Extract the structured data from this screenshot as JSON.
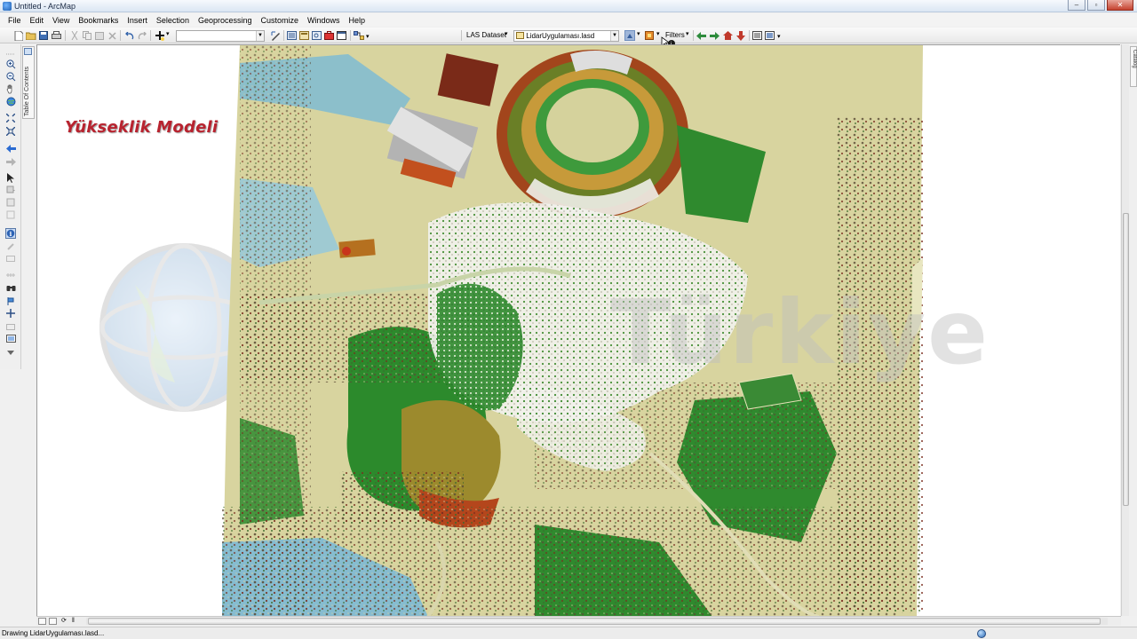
{
  "window": {
    "title": "Untitled - ArcMap"
  },
  "menu": [
    "File",
    "Edit",
    "View",
    "Bookmarks",
    "Insert",
    "Selection",
    "Geoprocessing",
    "Customize",
    "Windows",
    "Help"
  ],
  "toolbar": {
    "scale_value": "",
    "las_dataset_label": "LAS Dataset",
    "las_layer_value": "LidarUygulaması.lasd",
    "filters_label": "Filters"
  },
  "toc": {
    "label": "Table Of Contents"
  },
  "catalog": {
    "label": "Catalog"
  },
  "map": {
    "overlay_title": "Yükseklik Modeli",
    "watermark_text": "Türkiye"
  },
  "status": {
    "text": "Drawing LidarUygulaması.lasd..."
  }
}
